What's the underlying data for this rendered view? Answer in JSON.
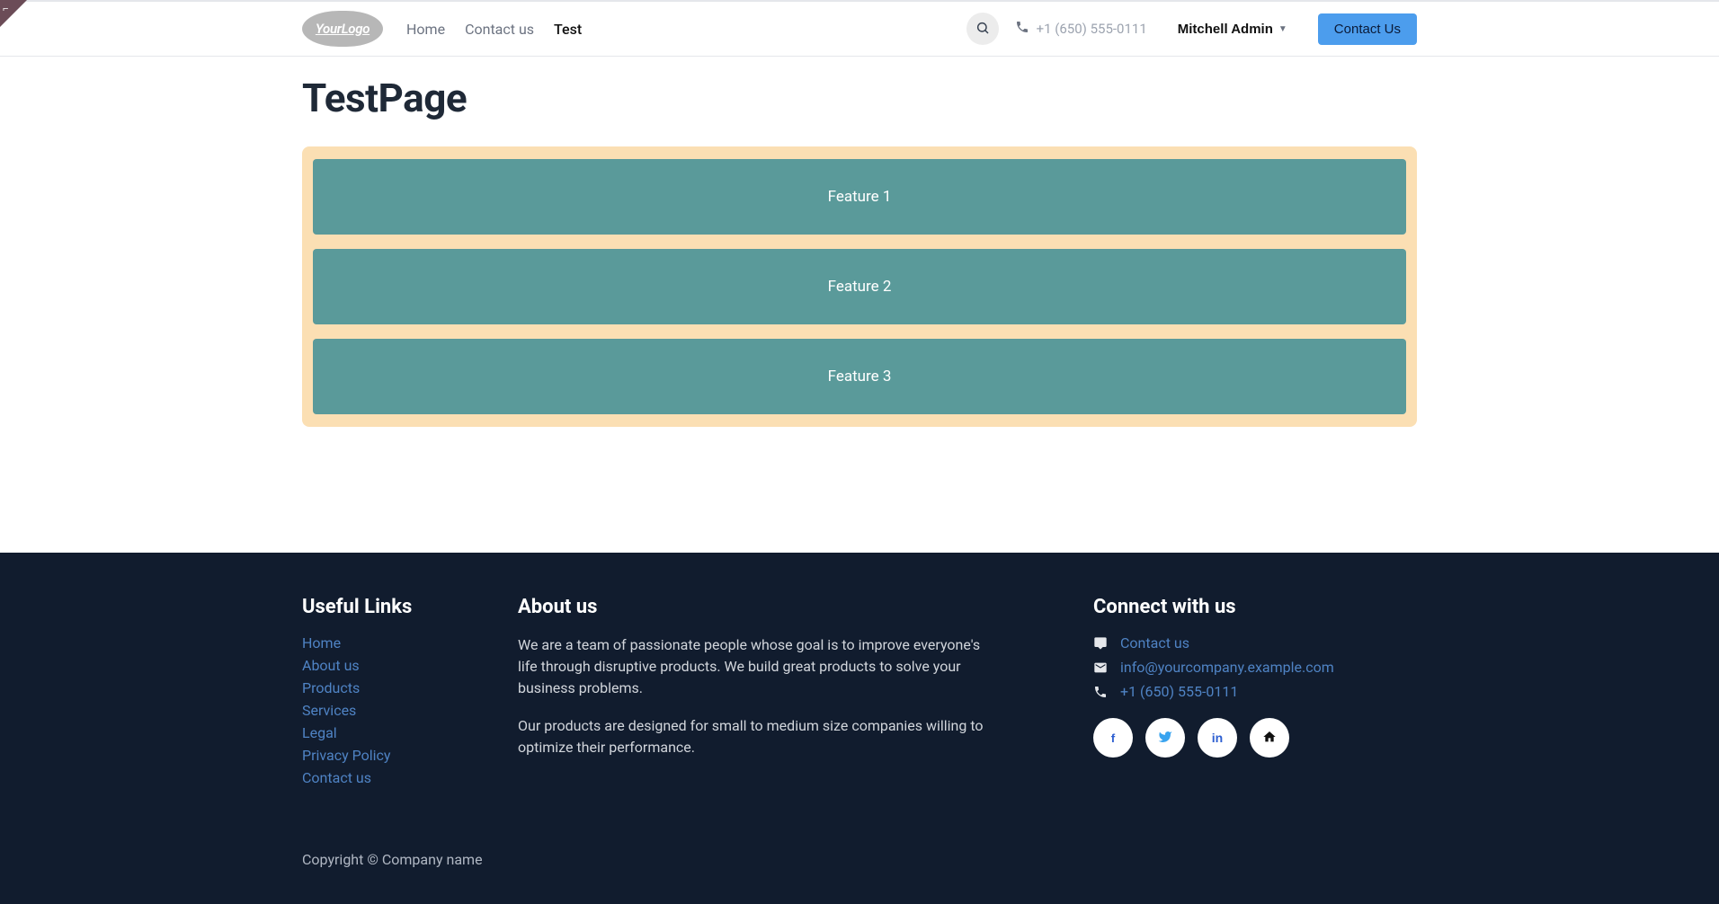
{
  "header": {
    "logo_text": "YourLogo",
    "nav": [
      {
        "label": "Home",
        "active": false
      },
      {
        "label": "Contact us",
        "active": false
      },
      {
        "label": "Test",
        "active": true
      }
    ],
    "phone": "+1 (650) 555-0111",
    "user": "Mitchell Admin",
    "contact_btn": "Contact Us"
  },
  "page": {
    "title": "TestPage",
    "features": [
      "Feature 1",
      "Feature 2",
      "Feature 3"
    ]
  },
  "footer": {
    "useful_title": "Useful Links",
    "useful_links": [
      "Home",
      "About us",
      "Products",
      "Services",
      "Legal",
      "Privacy Policy",
      "Contact us"
    ],
    "about_title": "About us",
    "about_p1": "We are a team of passionate people whose goal is to improve everyone's life through disruptive products. We build great products to solve your business problems.",
    "about_p2": "Our products are designed for small to medium size companies willing to optimize their performance.",
    "connect_title": "Connect with us",
    "connect_contact": "Contact us",
    "connect_email": "info@yourcompany.example.com",
    "connect_phone": "+1 (650) 555-0111",
    "copyright": "Copyright © Company name"
  }
}
